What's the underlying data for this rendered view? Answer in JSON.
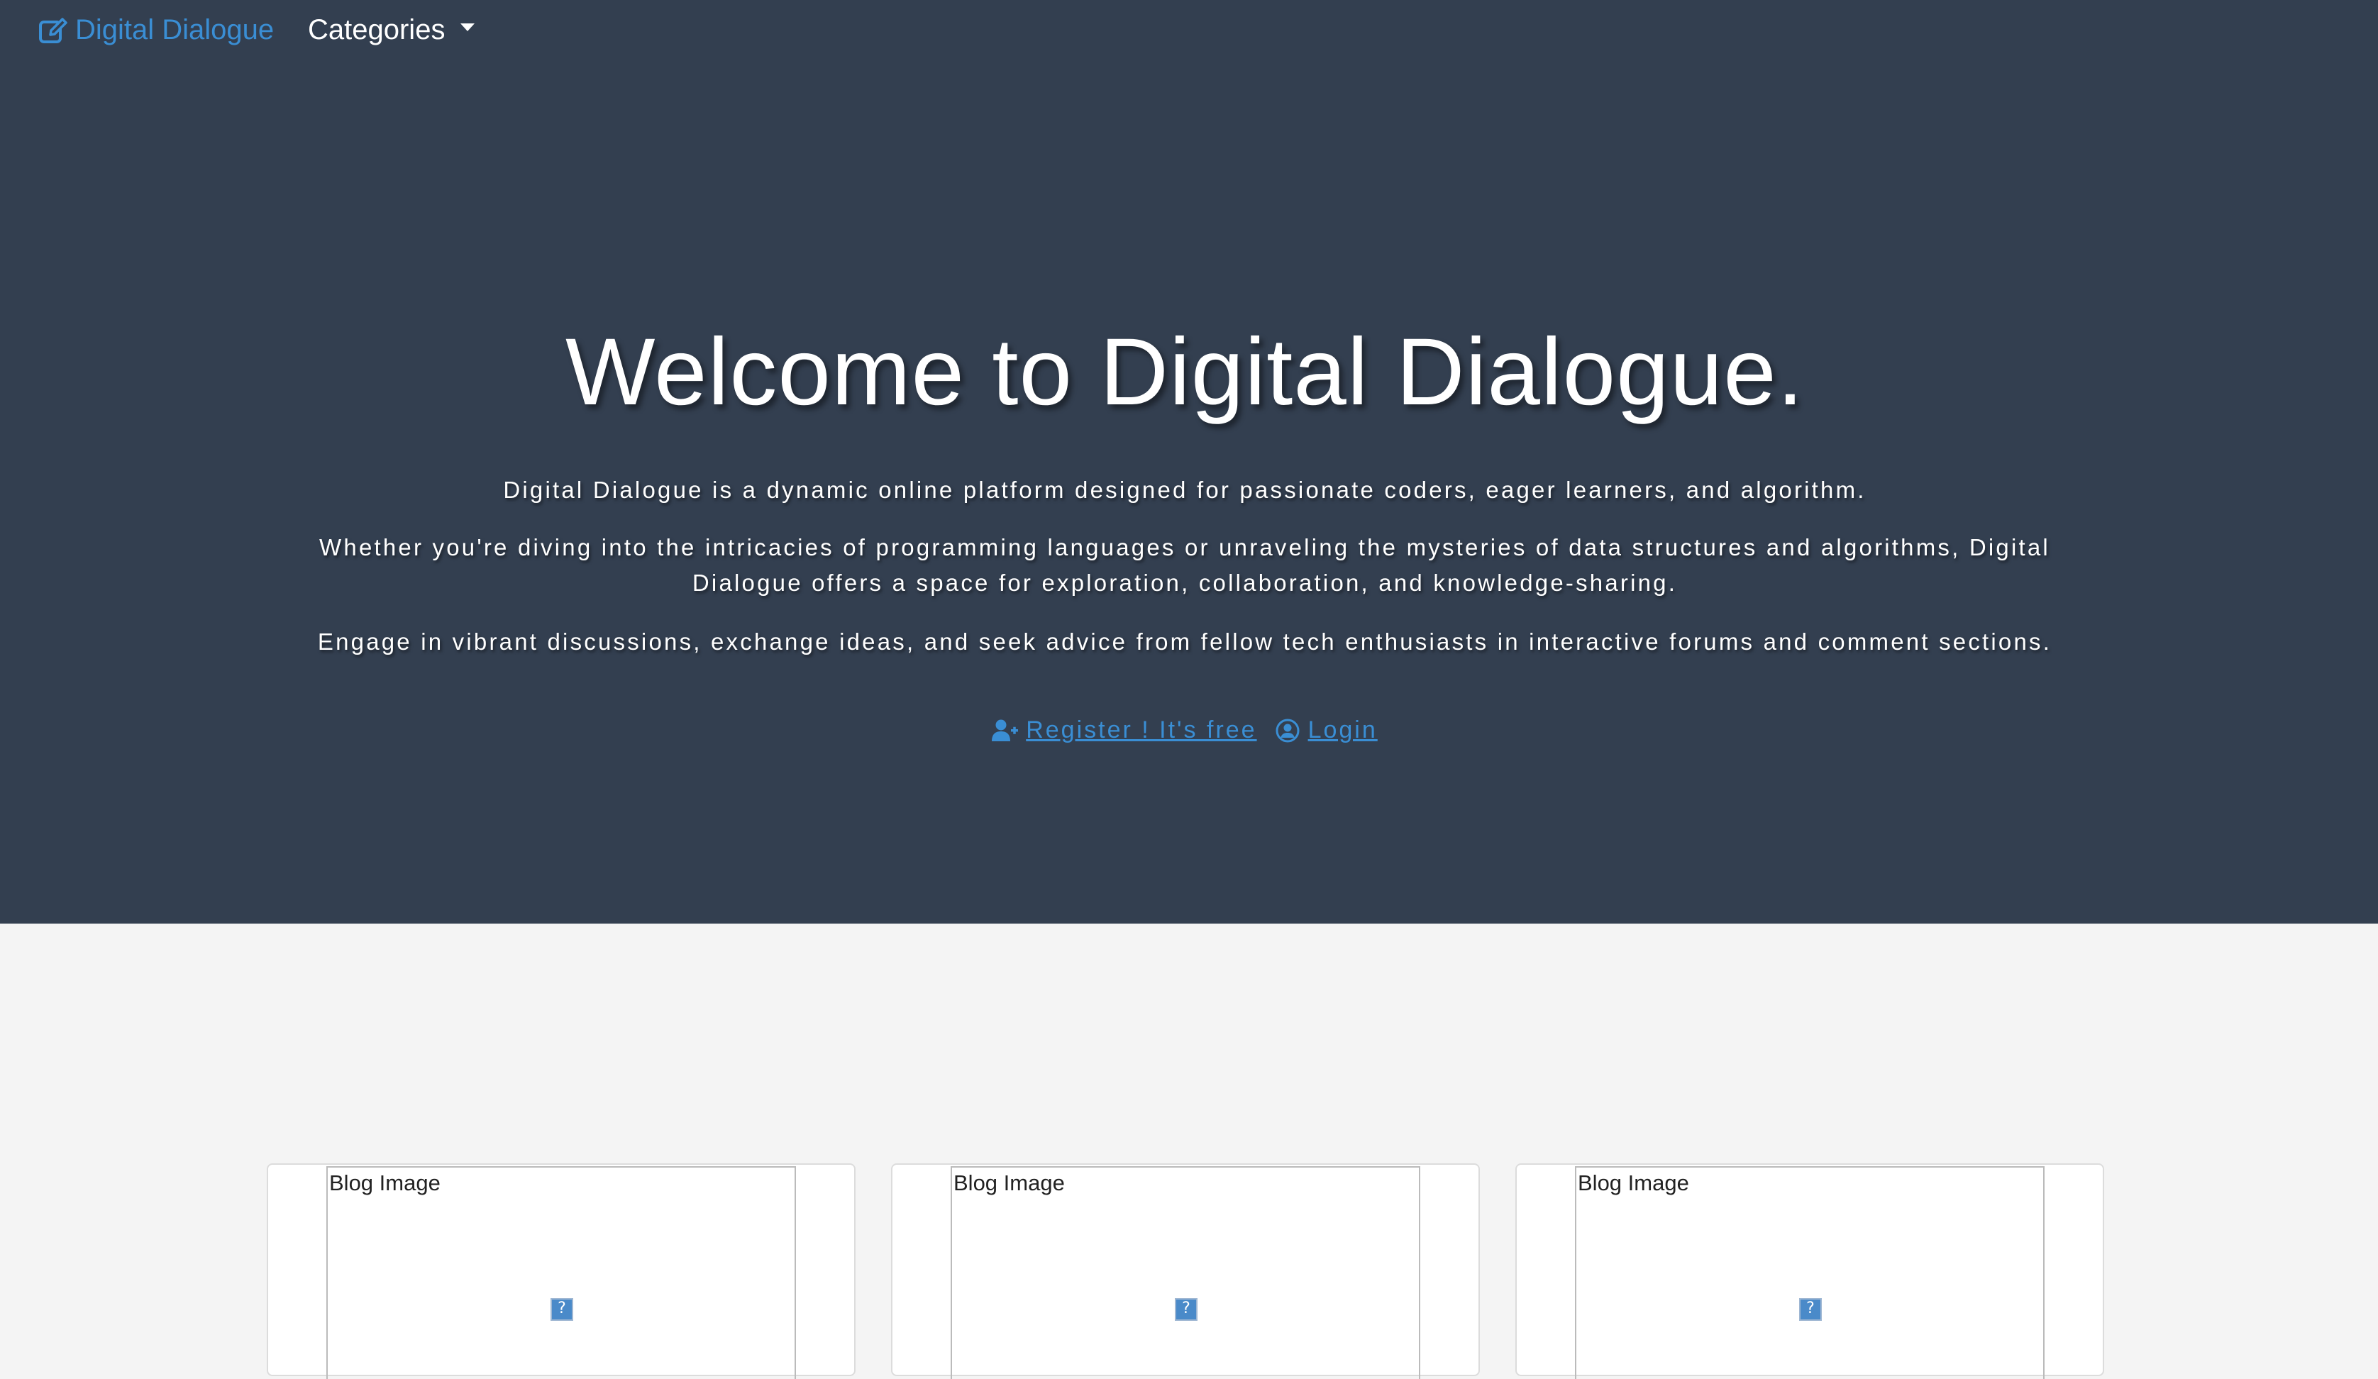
{
  "navbar": {
    "brand": "Digital Dialogue",
    "brand_icon": "edit-square-icon",
    "categories_label": "Categories",
    "categories_icon": "caret-down-icon"
  },
  "hero": {
    "title": "Welcome to Digital Dialogue.",
    "paragraph1": "Digital Dialogue is a dynamic online platform designed for passionate coders, eager learners, and algorithm.",
    "paragraph2": "Whether you're diving into the intricacies of programming languages or unraveling the mysteries of data structures and algorithms, Digital Dialogue offers a space for exploration, collaboration, and knowledge-sharing.",
    "paragraph3": "Engage in vibrant discussions, exchange ideas, and seek advice from fellow tech enthusiasts in interactive forums and comment sections.",
    "register_label": " Register ! It's free ",
    "register_icon": "user-plus-icon",
    "login_label": " Login",
    "login_icon": "user-circle-icon",
    "background_color": "#333f50",
    "link_color": "#3a8ed4"
  },
  "cards": [
    {
      "image_alt": "Blog Image",
      "image_icon": "broken-image-icon"
    },
    {
      "image_alt": "Blog Image",
      "image_icon": "broken-image-icon"
    },
    {
      "image_alt": "Blog Image",
      "image_icon": "broken-image-icon"
    }
  ]
}
